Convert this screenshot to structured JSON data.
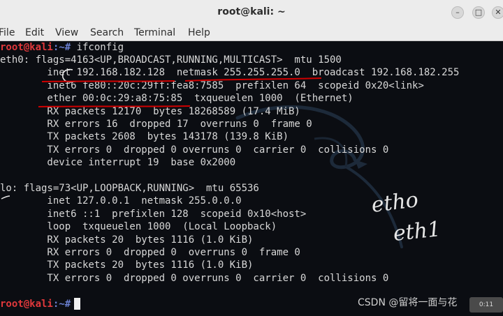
{
  "window": {
    "title": "root@kali: ~",
    "buttons": {
      "minimize": "–",
      "maximize": "□",
      "close": "✕"
    }
  },
  "menu": [
    "File",
    "Edit",
    "View",
    "Search",
    "Terminal",
    "Help"
  ],
  "prompt": {
    "user": "root@kali",
    "path": ":~# "
  },
  "command": "ifconfig",
  "output": [
    "eth0: flags=4163<UP,BROADCAST,RUNNING,MULTICAST>  mtu 1500",
    "        inet 192.168.182.128  netmask 255.255.255.0  broadcast 192.168.182.255",
    "        inet6 fe80::20c:29ff:fea8:7585  prefixlen 64  scopeid 0x20<link>",
    "        ether 00:0c:29:a8:75:85  txqueuelen 1000  (Ethernet)",
    "        RX packets 12170  bytes 18268589 (17.4 MiB)",
    "        RX errors 16  dropped 17  overruns 0  frame 0",
    "        TX packets 2608  bytes 143178 (139.8 KiB)",
    "        TX errors 0  dropped 0 overruns 0  carrier 0  collisions 0",
    "        device interrupt 19  base 0x2000",
    "",
    "lo: flags=73<UP,LOOPBACK,RUNNING>  mtu 65536",
    "        inet 127.0.0.1  netmask 255.0.0.0",
    "        inet6 ::1  prefixlen 128  scopeid 0x10<host>",
    "        loop  txqueuelen 1000  (Local Loopback)",
    "        RX packets 20  bytes 1116 (1.0 KiB)",
    "        RX errors 0  dropped 0  overruns 0  frame 0",
    "        TX packets 20  bytes 1116 (1.0 KiB)",
    "        TX errors 0  dropped 0 overruns 0  carrier 0  collisions 0",
    ""
  ],
  "annotations": {
    "handwriting": [
      "etho",
      "eth1"
    ]
  },
  "watermark": "CSDN @留将一面与花",
  "corner_badge": "0:11",
  "colors": {
    "prompt_user": "#e0383b",
    "prompt_sep": "#6a7fd0",
    "annotation": "#d00000"
  }
}
